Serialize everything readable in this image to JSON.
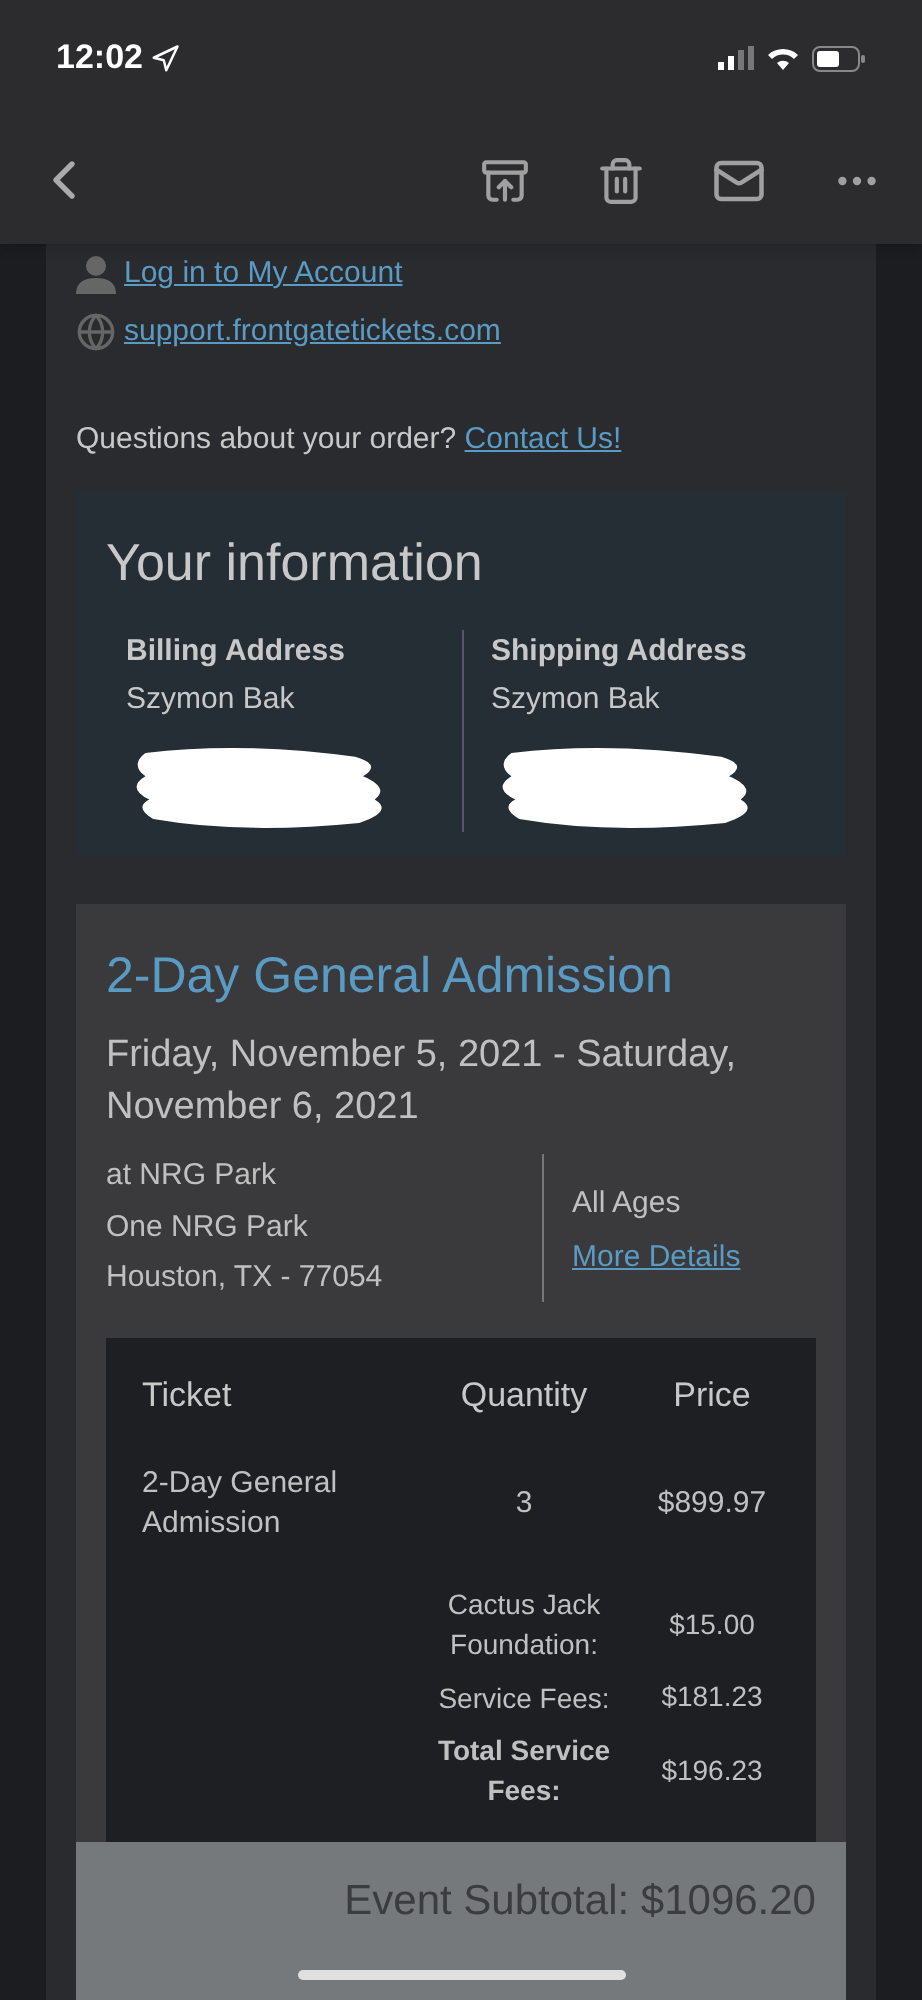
{
  "status_bar": {
    "time": "12:02"
  },
  "links": [
    {
      "kind": "person",
      "label": "Log in to My Account"
    },
    {
      "kind": "globe",
      "label": "support.frontgatetickets.com"
    }
  ],
  "questions": {
    "text": "Questions about your order?",
    "link": "Contact Us!"
  },
  "your_information": {
    "title": "Your information",
    "addresses": [
      {
        "heading": "Billing Address",
        "name": "Szymon Bak"
      },
      {
        "heading": "Shipping Address",
        "name": "Szymon Bak"
      }
    ]
  },
  "event": {
    "title": "2-Day General Admission",
    "dates": "Friday, November 5, 2021 - Saturday, November 6, 2021",
    "venue": [
      "at NRG Park",
      "One NRG Park",
      "Houston, TX - 77054"
    ],
    "age": "All Ages",
    "details_link": "More Details",
    "table": {
      "columns": [
        "Ticket",
        "Quantity",
        "Price"
      ],
      "rows": [
        {
          "ticket": "2-Day General Admission",
          "quantity": "3",
          "price": "$899.97"
        }
      ],
      "fees": [
        {
          "label": "Cactus Jack Foundation:",
          "amount": "$15.00",
          "bold": false
        },
        {
          "label": "Service Fees:",
          "amount": "$181.23",
          "bold": false
        },
        {
          "label": "Total Service Fees:",
          "amount": "$196.23",
          "bold": true
        }
      ]
    },
    "subtotal": "Event Subtotal: $1096.20"
  }
}
